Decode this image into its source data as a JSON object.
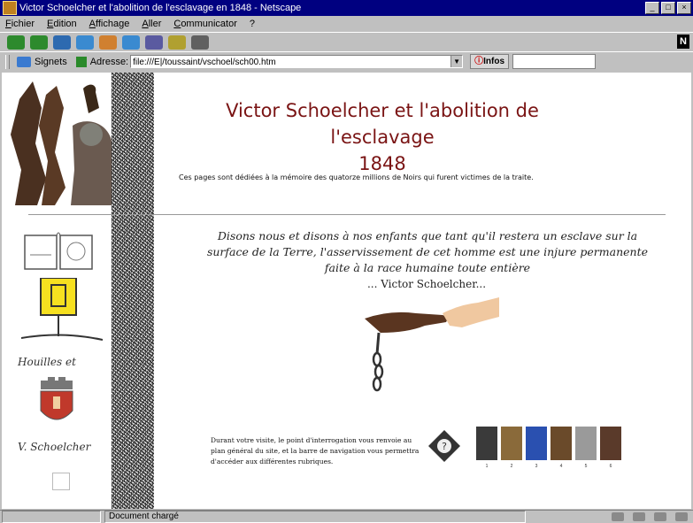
{
  "window": {
    "title": "Victor Schoelcher et l'abolition de l'esclavage en 1848 - Netscape",
    "controls": [
      "_",
      "□",
      "×"
    ]
  },
  "menu": [
    "Fichier",
    "Edition",
    "Affichage",
    "Aller",
    "Communicator",
    "?"
  ],
  "location_bar": {
    "bookmarks_label": "Signets",
    "address_label": "Adresse:",
    "url": "file:///E|/toussaint/vschoel/sch00.htm",
    "info_button": "Infos"
  },
  "page": {
    "title_line1": "Victor Schoelcher et l'abolition de l'esclavage",
    "title_line2": "1848",
    "dedication": "Ces pages sont dédiées à la mémoire des quatorze millions de Noirs qui furent victimes de la traite.",
    "quote_line1": "Disons nous et disons à nos enfants que tant qu'il restera un esclave sur la",
    "quote_line2": "surface de la Terre, l'asservissement de cet homme est une injure permanente",
    "quote_line3": "faite à la race humaine toute entière",
    "attribution": "... Victor Schoelcher...",
    "nav_text": "Durant votre visite, le point d'interrogation vous renvoie au plan général du site, et la barre de navigation vous permettra d'accéder aux différentes rubriques.",
    "thumb_labels": [
      "1",
      "2",
      "3",
      "4",
      "5",
      "6"
    ]
  },
  "sidebar": {
    "label_1": "Houilles et",
    "label_2": "V. Schoelcher"
  },
  "status": {
    "text": "Document chargé"
  },
  "colors": {
    "title": "#7a1414",
    "titlebar": "#000080"
  }
}
